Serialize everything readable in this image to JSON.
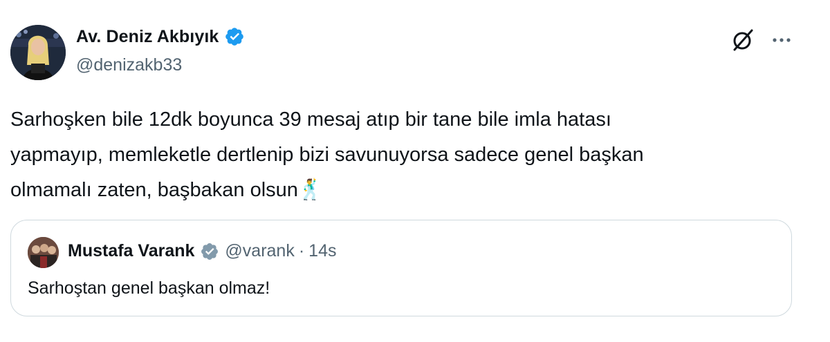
{
  "author": {
    "name": "Av. Deniz Akbıyık",
    "handle": "@denizakb33",
    "verified": true
  },
  "tweet": {
    "lines": [
      "Sarhoşken bile 12dk boyunca 39 mesaj atıp bir tane bile imla hatası",
      "yapmayıp, memleketle dertlenip bizi savunuyorsa sadece genel başkan",
      "olmamalı zaten, başbakan olsun"
    ],
    "emoji": "🕺"
  },
  "quoted": {
    "name": "Mustafa Varank",
    "handle": "@varank",
    "separator": "·",
    "time": "14s",
    "verified_color": "gray",
    "text": "Sarhoştan genel başkan olmaz!"
  },
  "icons": {
    "verified": "verified-badge-icon",
    "grok": "grok-icon",
    "more": "more-icon"
  },
  "colors": {
    "text": "#0f1419",
    "secondary": "#536471",
    "verified_blue": "#1d9bf0",
    "verified_gray": "#829aab",
    "border": "#cfd9de"
  }
}
